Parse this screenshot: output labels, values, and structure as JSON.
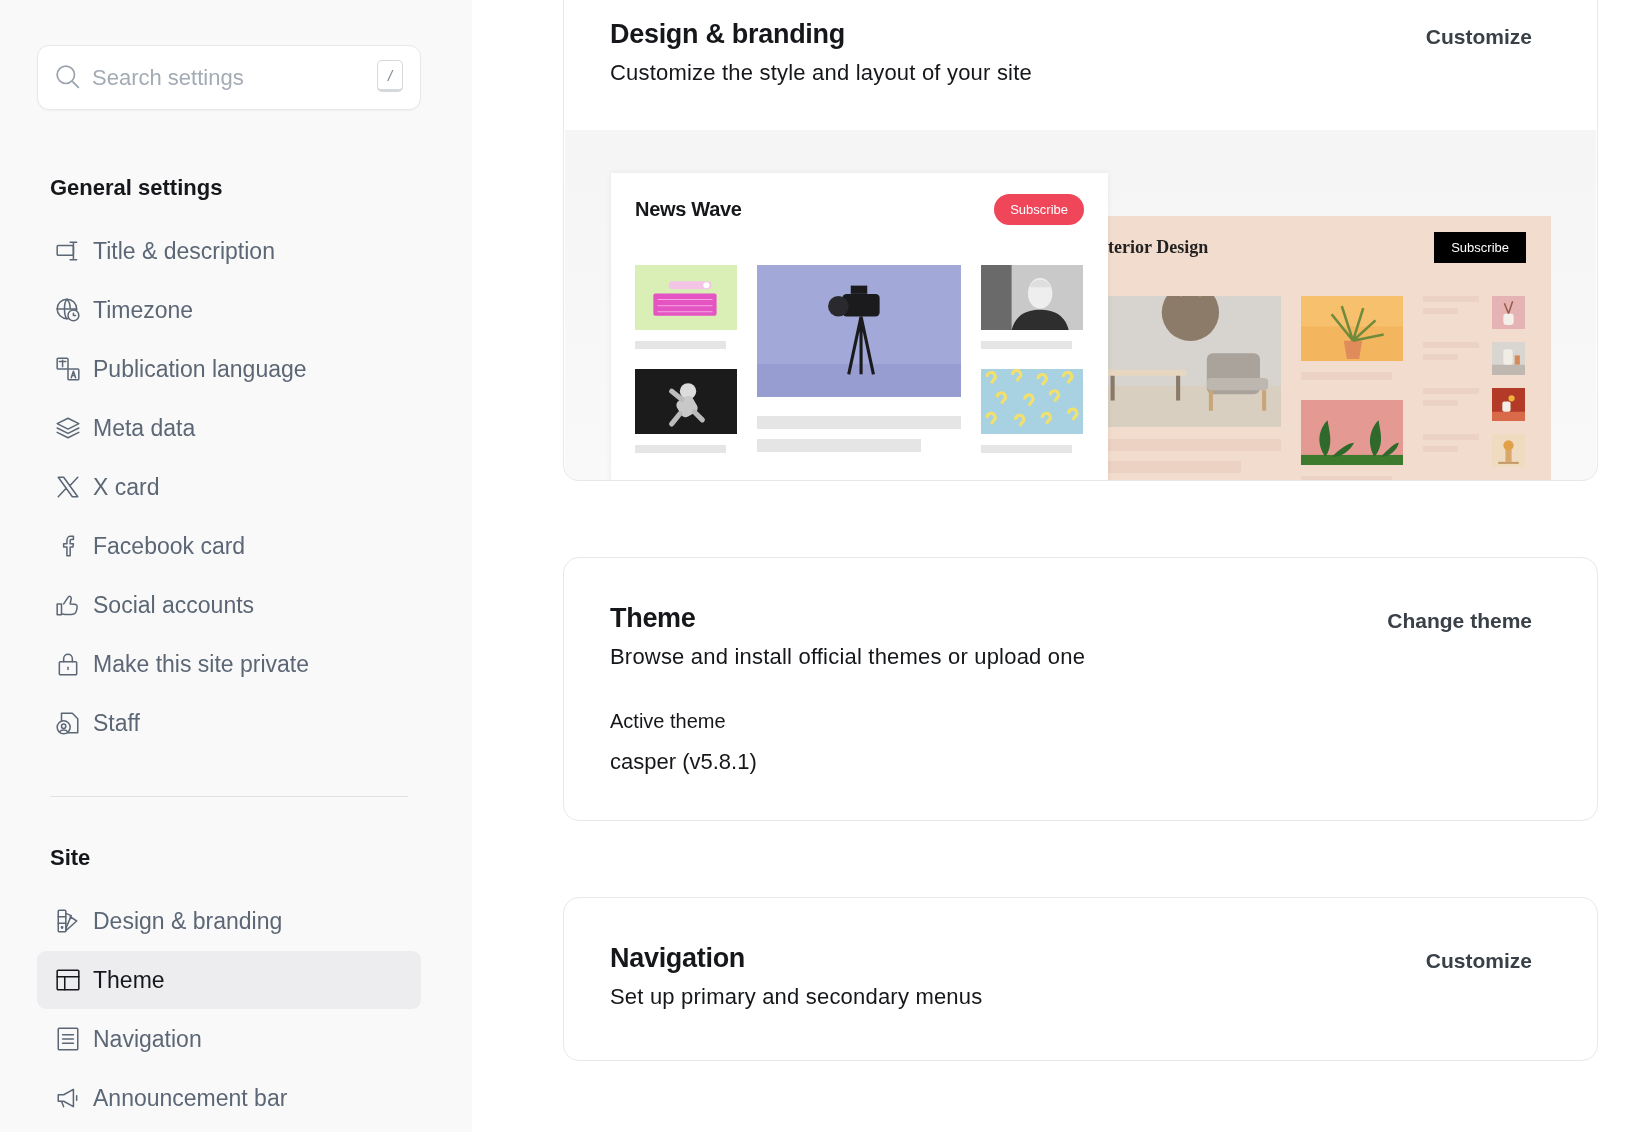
{
  "search": {
    "placeholder": "Search settings",
    "shortcut": "/"
  },
  "sidebar": {
    "sections": [
      {
        "title": "General settings",
        "items": [
          {
            "label": "Title & description",
            "selected": false
          },
          {
            "label": "Timezone",
            "selected": false
          },
          {
            "label": "Publication language",
            "selected": false
          },
          {
            "label": "Meta data",
            "selected": false
          },
          {
            "label": "X card",
            "selected": false
          },
          {
            "label": "Facebook card",
            "selected": false
          },
          {
            "label": "Social accounts",
            "selected": false
          },
          {
            "label": "Make this site private",
            "selected": false
          },
          {
            "label": "Staff",
            "selected": false
          }
        ]
      },
      {
        "title": "Site",
        "items": [
          {
            "label": "Design & branding",
            "selected": false
          },
          {
            "label": "Theme",
            "selected": true
          },
          {
            "label": "Navigation",
            "selected": false
          },
          {
            "label": "Announcement bar",
            "selected": false
          }
        ]
      }
    ]
  },
  "sections": [
    {
      "kind": "preview",
      "title": "Design & branding",
      "description": "Customize the style and layout of your site",
      "action": "Customize",
      "preview": {
        "sites": [
          {
            "title": "News Wave",
            "button": "Subscribe"
          },
          {
            "title": "terior Design",
            "button": "Subscribe"
          }
        ]
      }
    },
    {
      "kind": "details",
      "title": "Theme",
      "description": "Browse and install official themes or upload one",
      "action": "Change theme",
      "fields": [
        {
          "label": "Active theme",
          "value": "casper (v5.8.1)"
        }
      ]
    },
    {
      "kind": "plain",
      "title": "Navigation",
      "description": "Set up primary and secondary menus",
      "action": "Customize"
    }
  ]
}
